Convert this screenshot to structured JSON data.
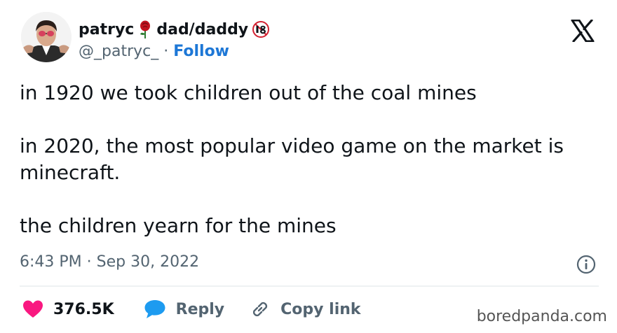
{
  "tweet": {
    "author": {
      "name": "patryc",
      "suffix": "dad/daddy",
      "handle": "@_patryc_",
      "follow_label": "Follow"
    },
    "text": {
      "line1": "in 1920 we took children out of the coal mines",
      "line2": "in 2020, the most popular video game on the market is minecraft.",
      "line3": "the children yearn for the mines"
    },
    "time": "6:43 PM",
    "date": "Sep 30, 2022",
    "separator": "·",
    "likes": "376.5K",
    "reply_label": "Reply",
    "copy_label": "Copy link"
  },
  "icons": {
    "rose": "rose-emoji-icon",
    "age": "age-18-icon",
    "x": "x-logo-icon",
    "info": "info-icon",
    "heart": "heart-icon",
    "reply": "reply-bubble-icon",
    "link": "link-icon"
  },
  "colors": {
    "accent": "#1d77d6",
    "heart": "#f91880",
    "reply": "#1d9bf0",
    "muted": "#536471",
    "text": "#0f1419"
  },
  "watermark": "boredpanda.com"
}
